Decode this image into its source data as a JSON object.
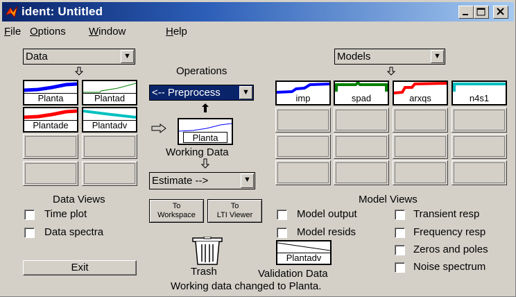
{
  "window": {
    "title": "ident: Untitled",
    "controls": {
      "minimize": "_",
      "maximize": "□",
      "close": "×"
    }
  },
  "menu": [
    {
      "label": "File",
      "key": "F",
      "rest": "ile"
    },
    {
      "label": "Options",
      "key": "O",
      "rest": "ptions"
    },
    {
      "label": "Window",
      "key": "W",
      "rest": "indow"
    },
    {
      "label": "Help",
      "key": "H",
      "rest": "elp"
    }
  ],
  "data_panel": {
    "select": "Data",
    "sets": [
      "Planta",
      "Plantad",
      "Plantade",
      "Plantadv"
    ],
    "views_title": "Data Views",
    "views": [
      "Time plot",
      "Data spectra"
    ],
    "exit_label": "Exit"
  },
  "operations": {
    "title": "Operations",
    "preprocess": "<-- Preprocess",
    "working_data_name": "Planta",
    "working_data_label": "Working Data",
    "estimate": "Estimate -->",
    "to_workspace": [
      "To",
      "Workspace"
    ],
    "to_lti": [
      "To",
      "LTI Viewer"
    ],
    "trash_label": "Trash",
    "validation_name": "Plantadv",
    "validation_label": "Validation Data"
  },
  "models_panel": {
    "select": "Models",
    "models": [
      "imp",
      "spad",
      "arxqs",
      "n4s1"
    ],
    "views_title": "Model Views",
    "views_left": [
      "Model output",
      "Model resids"
    ],
    "views_right": [
      "Transient resp",
      "Frequency resp",
      "Zeros and poles",
      "Noise spectrum"
    ]
  },
  "status": "Working data changed to Planta.",
  "colors": {
    "planta": "#0000ff",
    "plantad": "#008000",
    "plantade": "#ff0000",
    "plantadv": "#00c0c0",
    "imp": "#0000ff",
    "spad": "#008000",
    "arxqs": "#ff0000",
    "n4s1": "#00c0c0",
    "title_blue": "#0a246a"
  }
}
